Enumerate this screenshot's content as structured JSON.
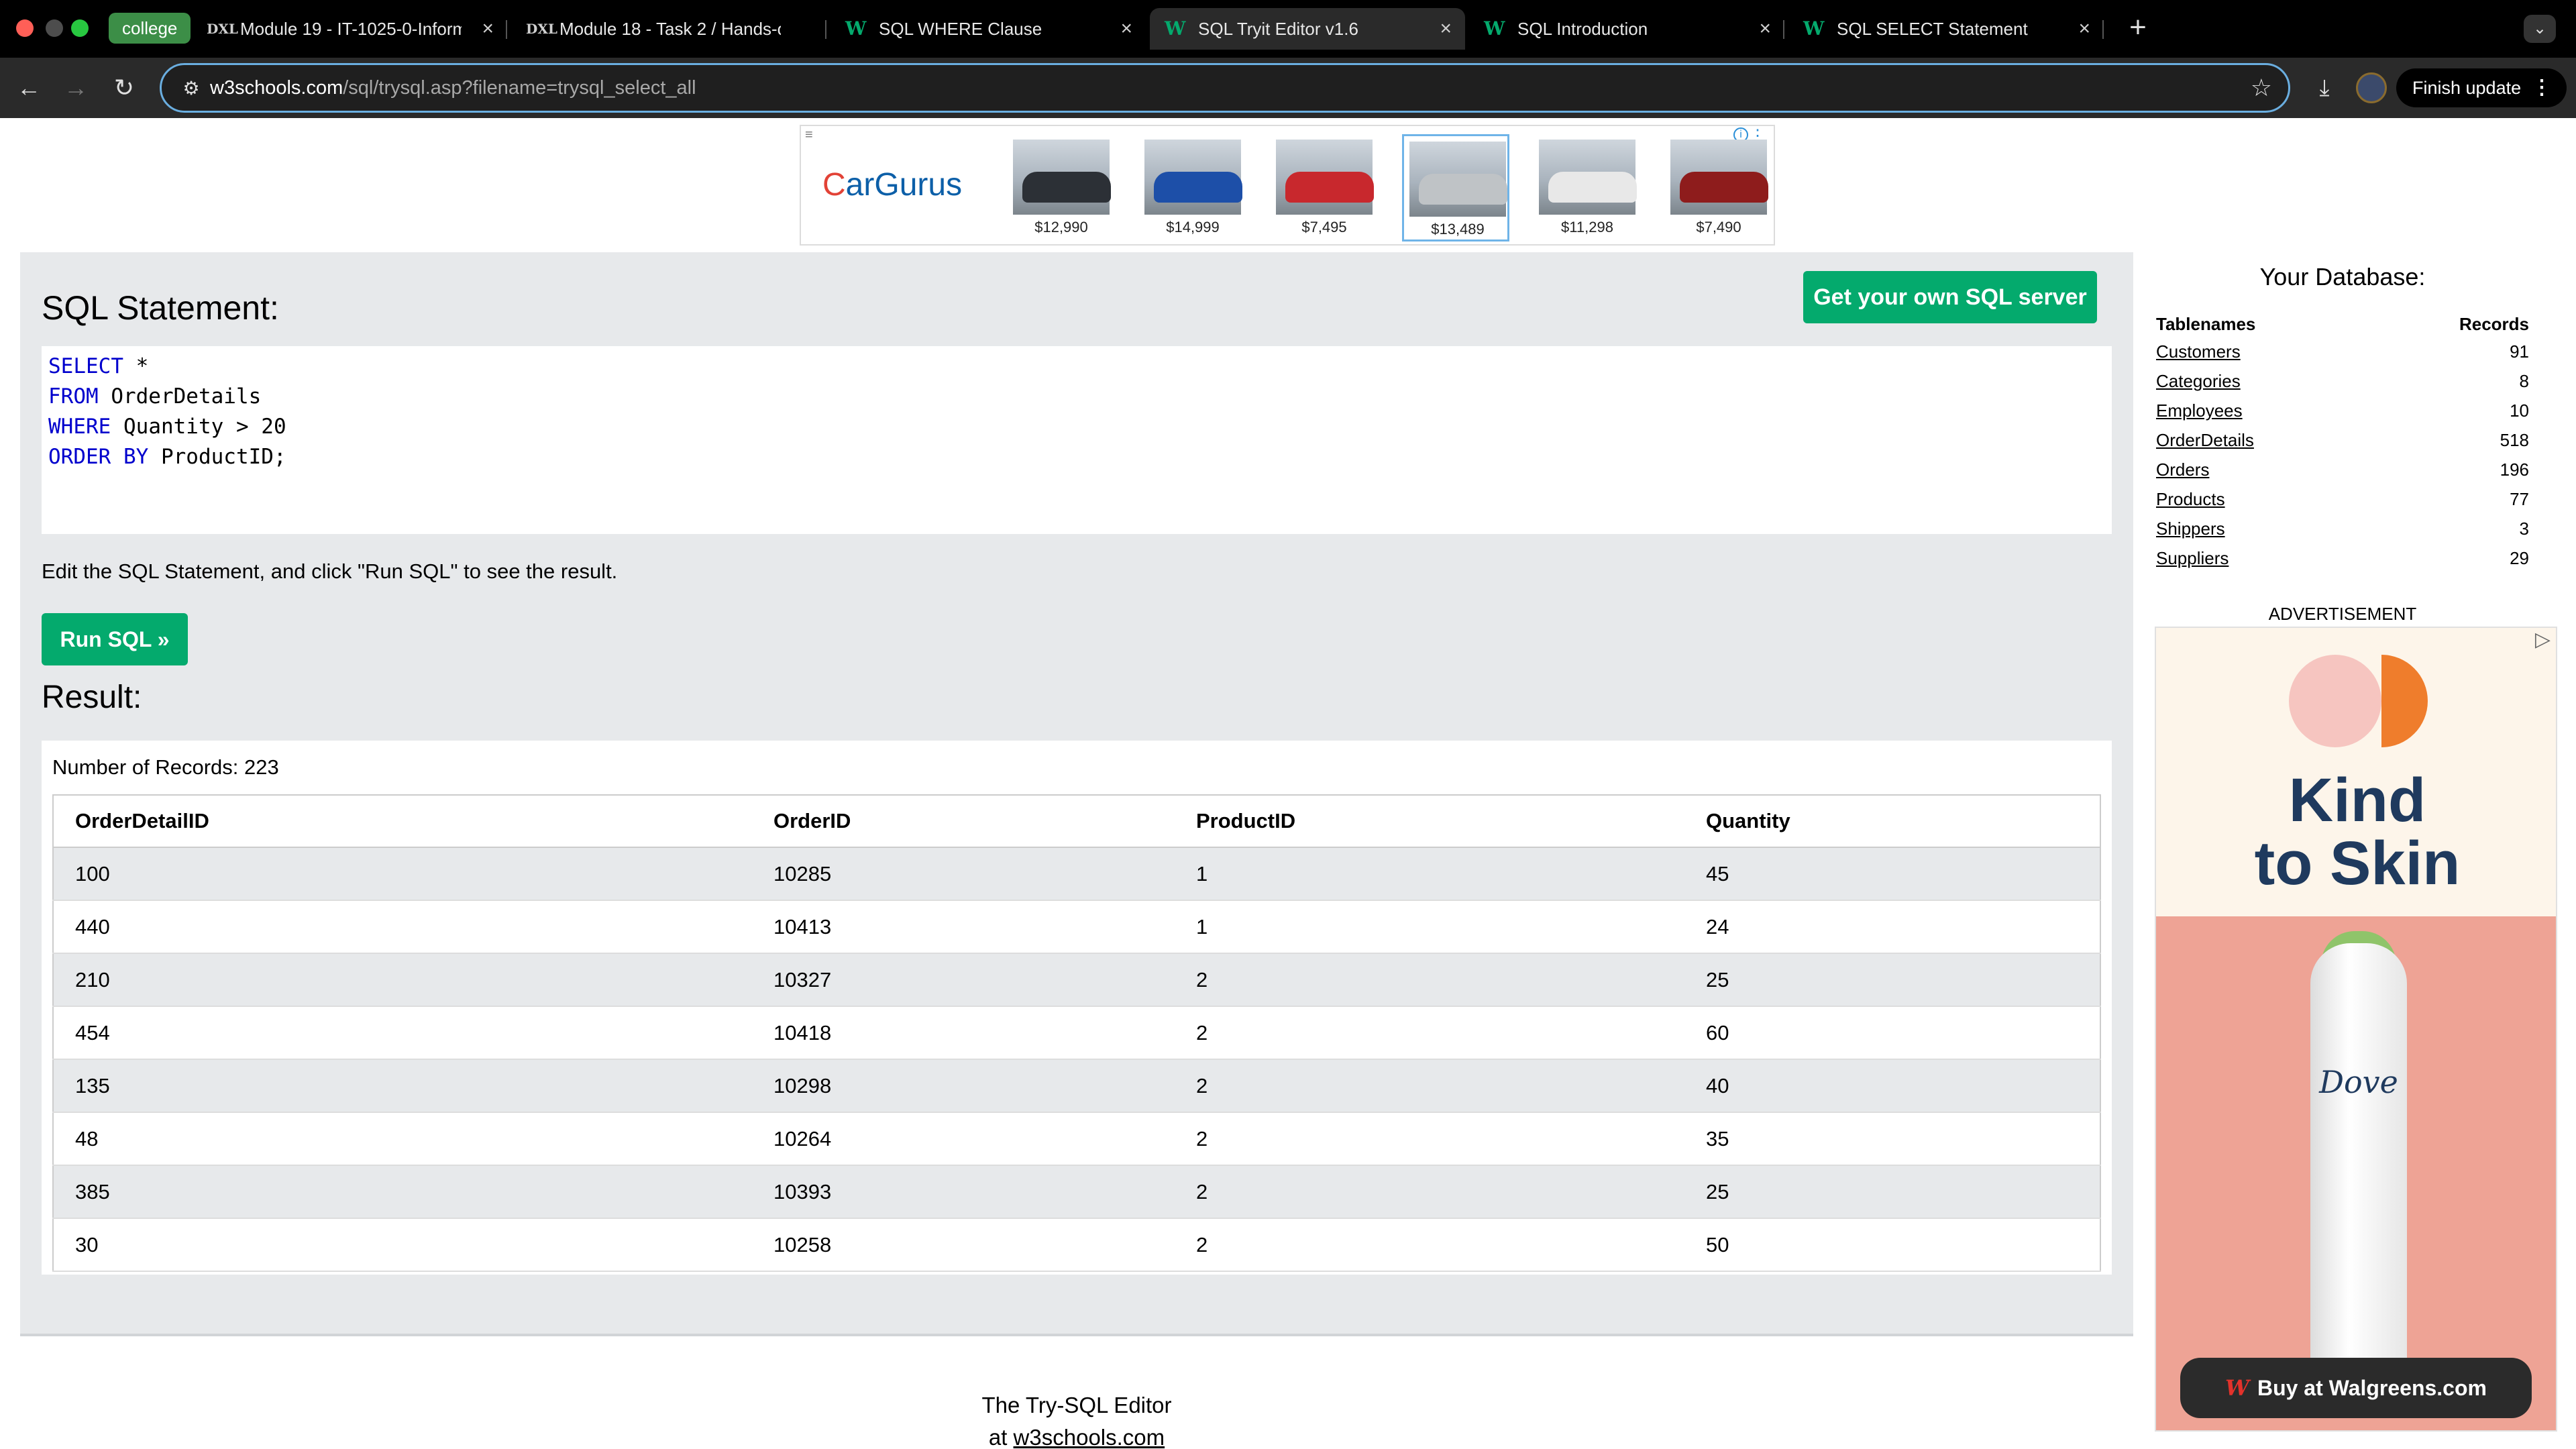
{
  "browser": {
    "tab_group_label": "college",
    "tabs": [
      {
        "title": "Module 19 - IT-1025-0-Inform",
        "icon": "DXL"
      },
      {
        "title": "Module 18 - Task 2 / Hands-o",
        "icon": "DXL"
      },
      {
        "title": "SQL WHERE Clause",
        "icon": "w3schools-icon"
      },
      {
        "title": "SQL Tryit Editor v1.6",
        "icon": "w3schools-icon",
        "active": true
      },
      {
        "title": "SQL Introduction",
        "icon": "w3schools-icon"
      },
      {
        "title": "SQL SELECT Statement",
        "icon": "w3schools-icon"
      }
    ],
    "url_host": "w3schools.com",
    "url_path": "/sql/trysql.asp?filename=trysql_select_all",
    "finish_update_label": "Finish update"
  },
  "top_ad": {
    "brand": "CarGurus",
    "brand_first_letter": "C",
    "brand_rest": "arGurus",
    "cars": [
      {
        "price": "$12,990",
        "color": "#2c3036"
      },
      {
        "price": "$14,999",
        "color": "#1d4fa8"
      },
      {
        "price": "$7,495",
        "color": "#c8282d"
      },
      {
        "price": "$13,489",
        "color": "#bfc3c6"
      },
      {
        "price": "$11,298",
        "color": "#e8e8e8"
      },
      {
        "price": "$7,490",
        "color": "#8e1c1c"
      }
    ]
  },
  "editor": {
    "heading": "SQL Statement:",
    "get_server_label": "Get your own SQL server",
    "code_lines": [
      {
        "kw": "SELECT",
        "rest": " *"
      },
      {
        "kw": "FROM",
        "rest": " OrderDetails"
      },
      {
        "kw": "WHERE",
        "rest": " Quantity > 20"
      },
      {
        "kw": "ORDER BY",
        "rest": " ProductID;"
      }
    ],
    "instruction": "Edit the SQL Statement, and click \"Run SQL\" to see the result.",
    "run_label": "Run SQL »"
  },
  "result": {
    "heading": "Result:",
    "record_count": "Number of Records: 223",
    "columns": [
      "OrderDetailID",
      "OrderID",
      "ProductID",
      "Quantity"
    ],
    "rows": [
      [
        "100",
        "10285",
        "1",
        "45"
      ],
      [
        "440",
        "10413",
        "1",
        "24"
      ],
      [
        "210",
        "10327",
        "2",
        "25"
      ],
      [
        "454",
        "10418",
        "2",
        "60"
      ],
      [
        "135",
        "10298",
        "2",
        "40"
      ],
      [
        "48",
        "10264",
        "2",
        "35"
      ],
      [
        "385",
        "10393",
        "2",
        "25"
      ],
      [
        "30",
        "10258",
        "2",
        "50"
      ]
    ]
  },
  "database": {
    "heading": "Your Database:",
    "col_tables": "Tablenames",
    "col_records": "Records",
    "tables": [
      {
        "name": "Customers",
        "records": "91"
      },
      {
        "name": "Categories",
        "records": "8"
      },
      {
        "name": "Employees",
        "records": "10"
      },
      {
        "name": "OrderDetails",
        "records": "518"
      },
      {
        "name": "Orders",
        "records": "196"
      },
      {
        "name": "Products",
        "records": "77"
      },
      {
        "name": "Shippers",
        "records": "3"
      },
      {
        "name": "Suppliers",
        "records": "29"
      }
    ]
  },
  "side_ad": {
    "label": "ADVERTISEMENT",
    "headline_line1": "Kind",
    "headline_line2": "to Skin",
    "product_brand": "Dove",
    "cta": "Buy at Walgreens.com",
    "cta_logo": "W"
  },
  "footer": {
    "line1": "The Try-SQL Editor",
    "line2_prefix": "at ",
    "line2_link": "w3schools.com"
  }
}
